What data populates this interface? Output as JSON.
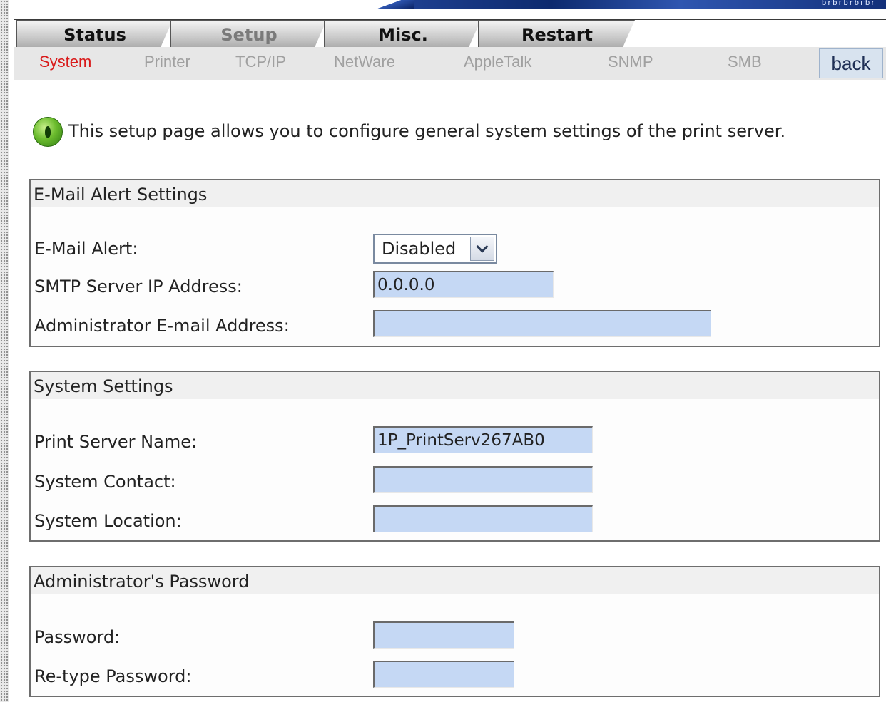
{
  "banner": {
    "text": "brbrbrbrbr"
  },
  "tabs": [
    {
      "label": "Status",
      "dim": false
    },
    {
      "label": "Setup",
      "dim": true
    },
    {
      "label": "Misc.",
      "dim": false
    },
    {
      "label": "Restart",
      "dim": false
    }
  ],
  "subnav": {
    "items": [
      "System",
      "Printer",
      "TCP/IP",
      "NetWare",
      "AppleTalk",
      "SNMP",
      "SMB"
    ],
    "active": "System",
    "back_label": "back"
  },
  "info": {
    "icon": "info-icon",
    "text": "This setup page allows you to configure general system settings of the print server."
  },
  "email_alert": {
    "title": "E-Mail Alert Settings",
    "alert_label": "E-Mail Alert:",
    "alert_value": "Disabled",
    "smtp_label": "SMTP Server IP Address:",
    "smtp_value": "0.0.0.0",
    "admin_email_label": "Administrator E-mail Address:",
    "admin_email_value": ""
  },
  "system": {
    "title": "System Settings",
    "name_label": "Print Server Name:",
    "name_value": "1P_PrintServ267AB0",
    "contact_label": "System Contact:",
    "contact_value": "",
    "location_label": "System Location:",
    "location_value": ""
  },
  "password": {
    "title": "Administrator's Password",
    "password_label": "Password:",
    "password_value": "",
    "retype_label": "Re-type Password:",
    "retype_value": ""
  },
  "colors": {
    "active_subnav": "#d91a1a",
    "field_bg": "#c5d8f4",
    "back_bg": "#d8e3ef"
  }
}
